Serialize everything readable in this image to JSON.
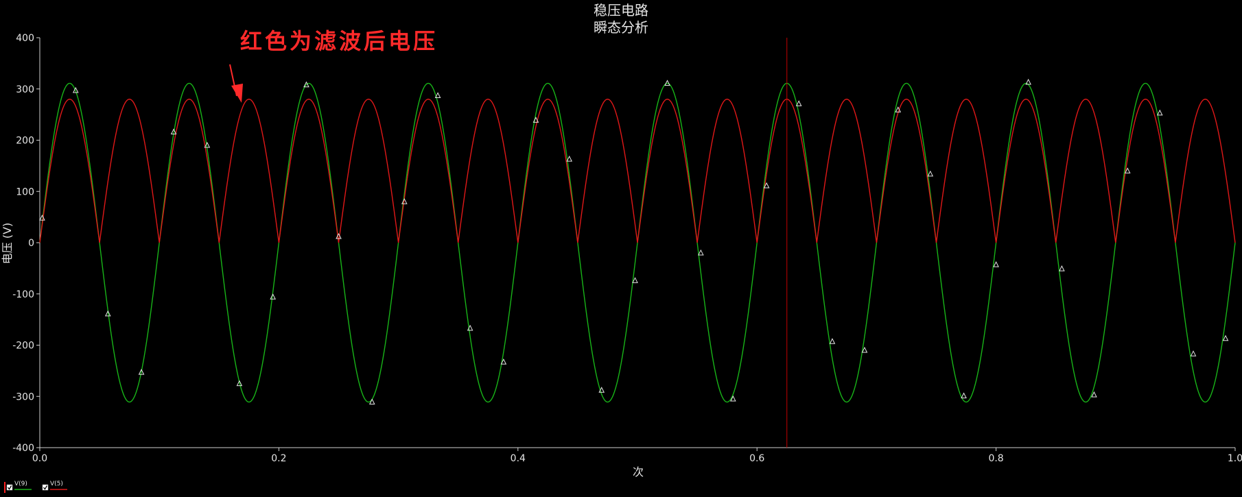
{
  "chart_data": {
    "type": "line",
    "title": "稳压电路",
    "subtitle": "瞬态分析",
    "xlabel": "次",
    "ylabel": "电压 (V)",
    "xlim": [
      0,
      1.0
    ],
    "ylim": [
      -400,
      400
    ],
    "x_ticks": [
      "0.0",
      "0.2",
      "0.4",
      "0.6",
      "0.8",
      "1.0"
    ],
    "y_ticks": [
      "400",
      "300",
      "200",
      "100",
      "0",
      "-100",
      "-200",
      "-300",
      "-400"
    ],
    "grid": false,
    "legend_position": "bottom-left",
    "cursor_x": 0.625,
    "annotation": "红色为滤波后电压",
    "series": [
      {
        "name": "V(9)",
        "color": "#18b418",
        "function": "sine",
        "amplitude": 311,
        "frequency": 10,
        "phase": 0,
        "marker": "triangle",
        "markers": [
          [
            0.002,
            48
          ],
          [
            0.03,
            297
          ],
          [
            0.057,
            -139
          ],
          [
            0.085,
            -253
          ],
          [
            0.112,
            216
          ],
          [
            0.14,
            190
          ],
          [
            0.167,
            -275
          ],
          [
            0.195,
            -106
          ],
          [
            0.223,
            308
          ],
          [
            0.25,
            12
          ],
          [
            0.278,
            -311
          ],
          [
            0.305,
            80
          ],
          [
            0.333,
            287
          ],
          [
            0.36,
            -167
          ],
          [
            0.388,
            -233
          ],
          [
            0.415,
            239
          ],
          [
            0.443,
            163
          ],
          [
            0.47,
            -288
          ],
          [
            0.498,
            -74
          ],
          [
            0.525,
            311
          ],
          [
            0.553,
            -20
          ],
          [
            0.58,
            -305
          ],
          [
            0.608,
            111
          ],
          [
            0.635,
            271
          ],
          [
            0.663,
            -193
          ],
          [
            0.69,
            -210
          ],
          [
            0.718,
            259
          ],
          [
            0.745,
            134
          ],
          [
            0.773,
            -299
          ],
          [
            0.8,
            -43
          ],
          [
            0.827,
            313
          ],
          [
            0.855,
            -51
          ],
          [
            0.882,
            -297
          ],
          [
            0.91,
            140
          ],
          [
            0.937,
            253
          ],
          [
            0.965,
            -217
          ],
          [
            0.992,
            -187
          ]
        ]
      },
      {
        "name": "V(5)",
        "color": "#e01818",
        "function": "full-wave rectified sine",
        "amplitude": 280,
        "frequency": 10,
        "phase": 0
      }
    ]
  }
}
